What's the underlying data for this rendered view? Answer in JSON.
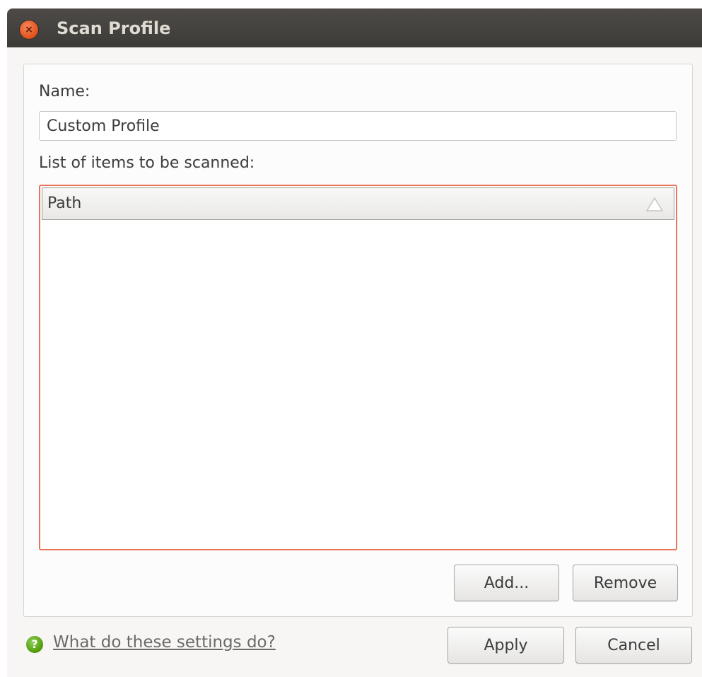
{
  "window": {
    "title": "Scan Profile",
    "close_glyph": "×"
  },
  "form": {
    "name_label": "Name:",
    "name_value": "Custom Profile",
    "list_label": "List of items to be scanned:",
    "list_column_header": "Path",
    "list_rows": [],
    "add_button": "Add...",
    "remove_button": "Remove"
  },
  "footer": {
    "help_link": "What do these settings do?",
    "help_icon_glyph": "?",
    "apply_button": "Apply",
    "cancel_button": "Cancel"
  },
  "colors": {
    "titlebar": "#3c3b37",
    "close_button": "#e2541f",
    "list_focus_border": "#e8745a",
    "help_icon": "#4e9a06"
  },
  "icons": {
    "close": "close-icon",
    "sort": "sort-triangle-icon",
    "help": "help-icon"
  }
}
